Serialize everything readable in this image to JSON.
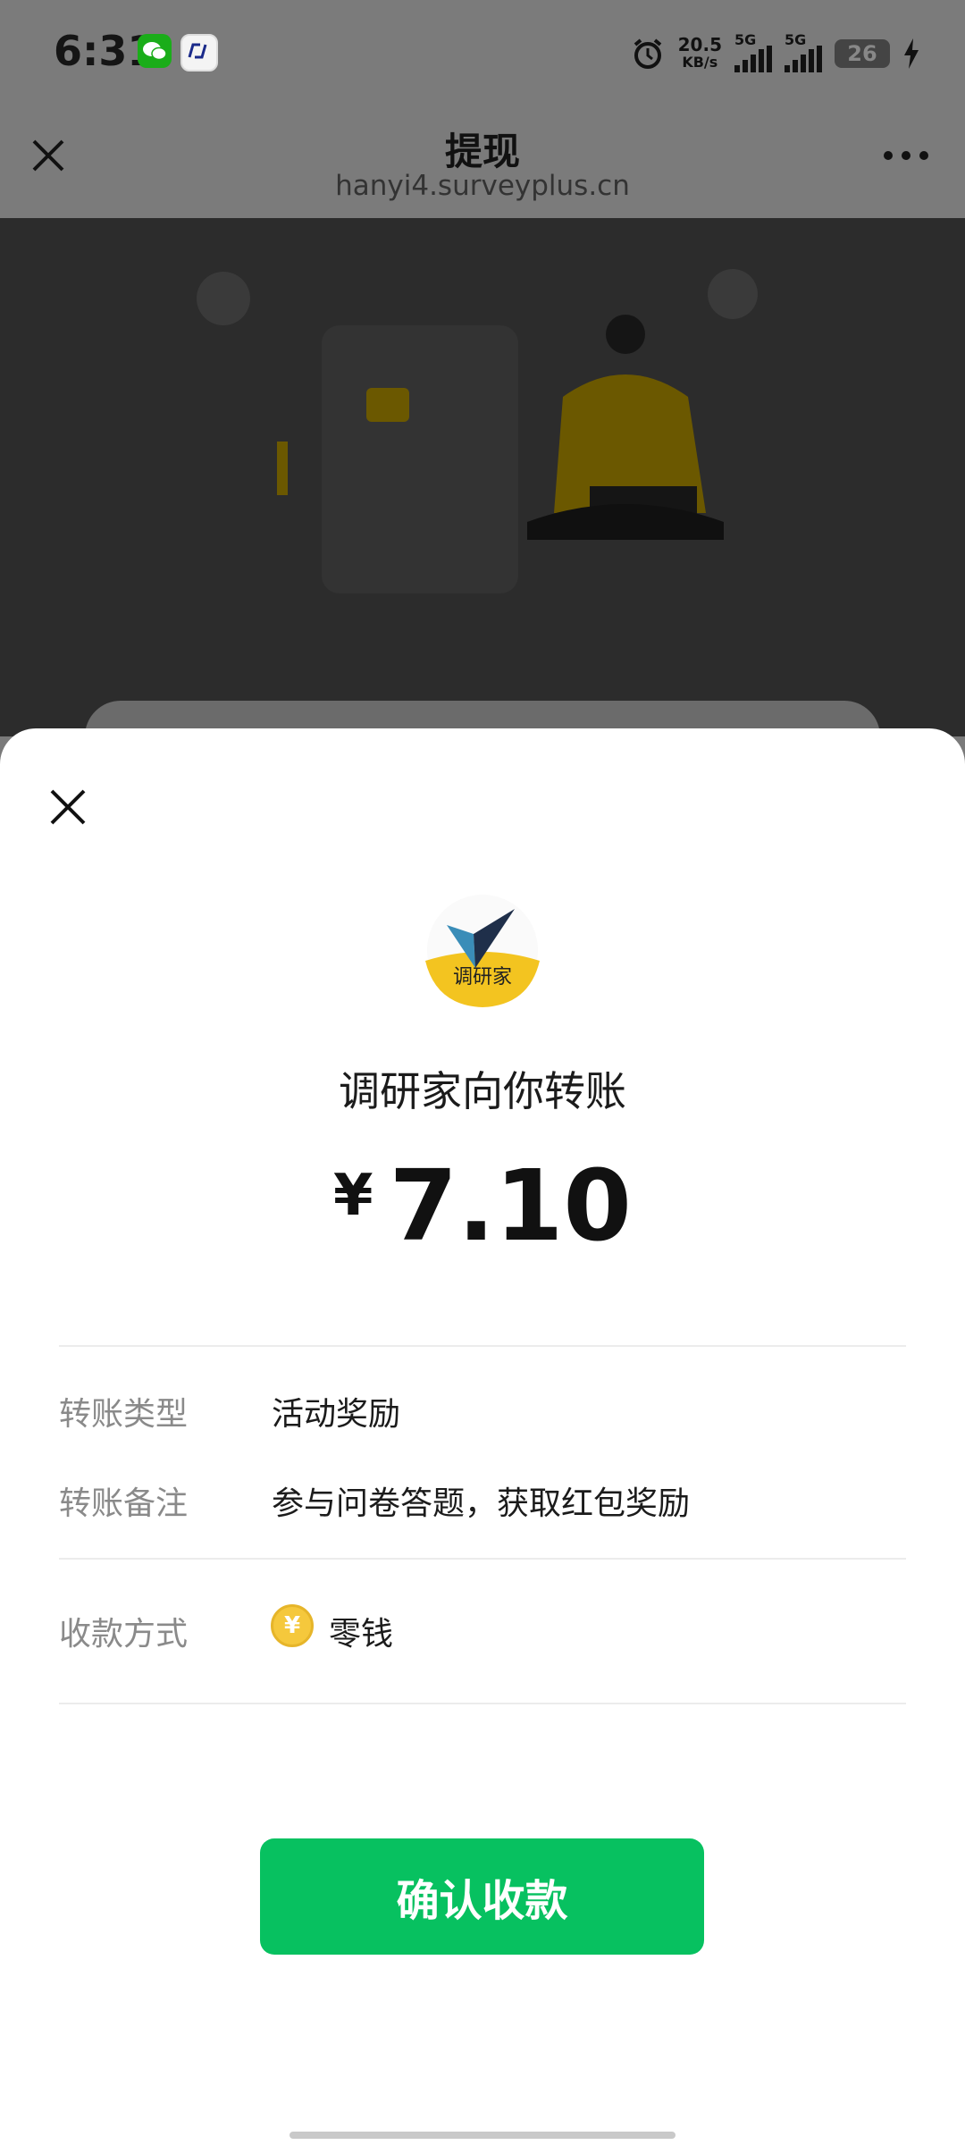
{
  "status_bar": {
    "time": "6:31",
    "net_speed_value": "20.5",
    "net_speed_unit": "KB/s",
    "signal1_label": "5G",
    "signal2_label": "5G",
    "battery": "26"
  },
  "header": {
    "title": "提现",
    "subtitle": "hanyi4.surveyplus.cn"
  },
  "logo": {
    "text": "调研家"
  },
  "sheet": {
    "payer_text": "调研家向你转账",
    "currency": "¥",
    "amount": "7.10",
    "transfer_type_label": "转账类型",
    "transfer_type_value": "活动奖励",
    "transfer_note_label": "转账备注",
    "transfer_note_value": "参与问卷答题，获取红包奖励",
    "receive_method_label": "收款方式",
    "receive_method_value": "零钱",
    "confirm_label": "确认收款"
  },
  "colors": {
    "primary_green": "#07c160",
    "coin_yellow": "#f5c83c"
  }
}
